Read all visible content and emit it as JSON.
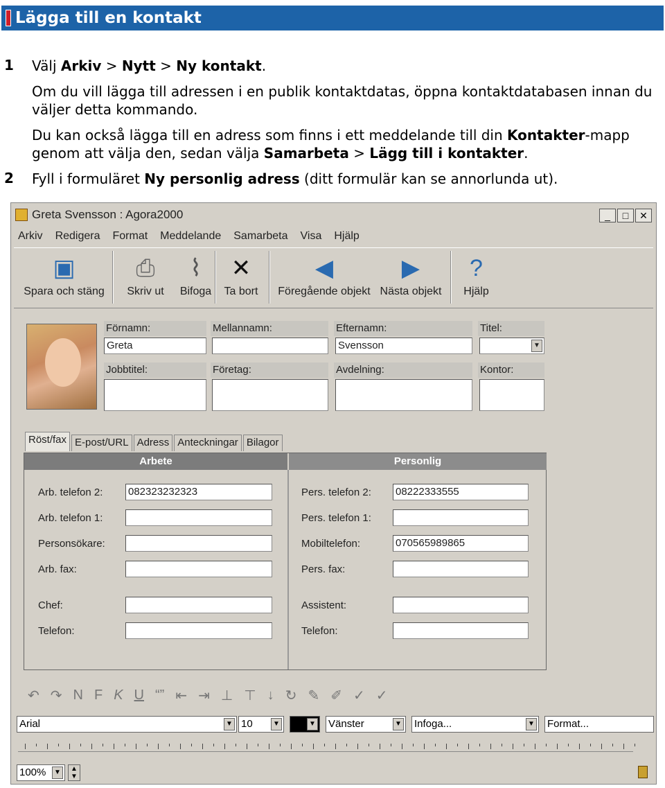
{
  "header": {
    "title": "Lägga till en kontakt"
  },
  "steps": [
    {
      "num": "1",
      "line1_pre": "Välj ",
      "menu1": "Arkiv",
      "sep": " > ",
      "menu2": "Nytt",
      "menu3": "Ny kontakt",
      "line1_post": ".",
      "p2": "Om du vill lägga till adressen i en publik kontaktdatas, öppna kontaktdatabasen innan du väljer detta kommando.",
      "p3_pre": "Du kan också lägga till en adress som finns i ett meddelande till din ",
      "p3_b1": "Kontakter",
      "p3_mid": "-mapp genom att välja den, sedan välja ",
      "p3_b2": "Samarbeta",
      "p3_b3": "Lägg till i kontakter",
      "p3_post": "."
    },
    {
      "num": "2",
      "pre": "Fyll i formuläret ",
      "bold": "Ny personlig adress",
      "post": " (ditt formulär kan se annorlunda ut)."
    }
  ],
  "window": {
    "title": "Greta Svensson : Agora2000",
    "menus": [
      "Arkiv",
      "Redigera",
      "Format",
      "Meddelande",
      "Samarbeta",
      "Visa",
      "Hjälp"
    ],
    "toolbar": [
      "Spara och stäng",
      "Skriv ut",
      "Bifoga",
      "Ta bort",
      "Föregående objekt",
      "Nästa objekt",
      "Hjälp"
    ],
    "fields": {
      "fornamn_label": "Förnamn:",
      "fornamn": "Greta",
      "mellannamn_label": "Mellannamn:",
      "mellannamn": "",
      "efternamn_label": "Efternamn:",
      "efternamn": "Svensson",
      "titel_label": "Titel:",
      "titel": "",
      "jobbtitel_label": "Jobbtitel:",
      "foretag_label": "Företag:",
      "avdelning_label": "Avdelning:",
      "kontor_label": "Kontor:"
    },
    "tabs": [
      "Röst/fax",
      "E-post/URL",
      "Adress",
      "Anteckningar",
      "Bilagor"
    ],
    "arbete": {
      "header": "Arbete",
      "rows": [
        {
          "label": "Arb. telefon 2:",
          "value": "082323232323"
        },
        {
          "label": "Arb. telefon 1:",
          "value": ""
        },
        {
          "label": "Personsökare:",
          "value": ""
        },
        {
          "label": "Arb. fax:",
          "value": ""
        },
        {
          "label": "Chef:",
          "value": ""
        },
        {
          "label": "Telefon:",
          "value": ""
        }
      ]
    },
    "personlig": {
      "header": "Personlig",
      "rows": [
        {
          "label": "Pers. telefon 2:",
          "value": "08222333555"
        },
        {
          "label": "Pers. telefon 1:",
          "value": ""
        },
        {
          "label": "Mobiltelefon:",
          "value": "070565989865"
        },
        {
          "label": "Pers. fax:",
          "value": ""
        },
        {
          "label": "Assistent:",
          "value": ""
        },
        {
          "label": "Telefon:",
          "value": ""
        }
      ]
    },
    "format": {
      "font": "Arial",
      "size": "10",
      "align": "Vänster",
      "insert": "Infoga...",
      "format": "Format...",
      "zoom": "100%"
    }
  }
}
